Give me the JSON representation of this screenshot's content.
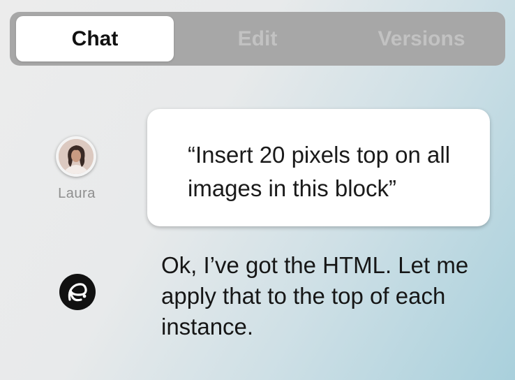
{
  "tabs": [
    {
      "label": "Chat",
      "active": true
    },
    {
      "label": "Edit",
      "active": false
    },
    {
      "label": "Versions",
      "active": false
    }
  ],
  "user": {
    "name": "Laura",
    "avatar_icon": "user-avatar-photo",
    "message": "“Insert 20 pixels top on all images in this block”"
  },
  "assistant": {
    "icon": "assistant-logo-icon",
    "message": "Ok, I’ve got the HTML. Let me apply that to the top of each instance."
  },
  "colors": {
    "tab_bar": "#a7a7a7",
    "active_tab": "#ffffff",
    "bubble": "#ffffff",
    "background_start": "#ececec",
    "background_end": "#a9d0dc"
  }
}
